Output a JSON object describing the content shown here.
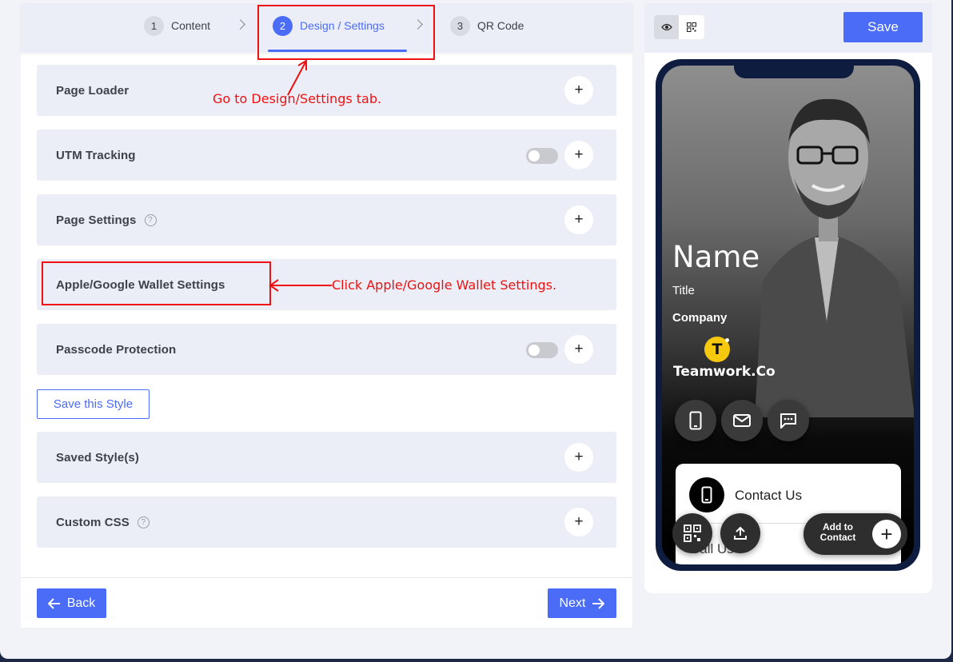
{
  "stepper": {
    "steps": [
      {
        "num": "1",
        "label": "Content"
      },
      {
        "num": "2",
        "label": "Design / Settings"
      },
      {
        "num": "3",
        "label": "QR Code"
      }
    ]
  },
  "panels": [
    {
      "label": "Page Loader"
    },
    {
      "label": "UTM Tracking"
    },
    {
      "label": "Page Settings"
    },
    {
      "label": "Apple/Google Wallet Settings"
    },
    {
      "label": "Passcode Protection"
    },
    {
      "label": "Saved Style(s)"
    },
    {
      "label": "Custom CSS"
    }
  ],
  "plus_symbol": "+",
  "help_symbol": "?",
  "save_style_label": "Save this Style",
  "footer": {
    "back_label": "Back",
    "next_label": "Next"
  },
  "annotations": {
    "design_tab": "Go to Design/Settings tab.",
    "wallet": "Click Apple/Google Wallet Settings."
  },
  "preview": {
    "save_label": "Save",
    "name": "Name",
    "title": "Title",
    "company": "Company",
    "logo_letter": "T",
    "logo_text": "Teamwork.Co",
    "contact_label": "Contact Us",
    "call_label": "Call Us",
    "add_contact_label": "Add to Contact",
    "add_symbol": "+"
  },
  "colors": {
    "accent": "#4a6cf7",
    "annotation": "#e11111",
    "phone_frame": "#0e1d3f"
  },
  "icons": [
    "eye-icon",
    "qr-icon",
    "arrow-left-icon",
    "arrow-right-icon",
    "chevron-right-icon",
    "phone-icon",
    "mail-icon",
    "chat-icon",
    "share-icon",
    "help-circle-icon"
  ]
}
